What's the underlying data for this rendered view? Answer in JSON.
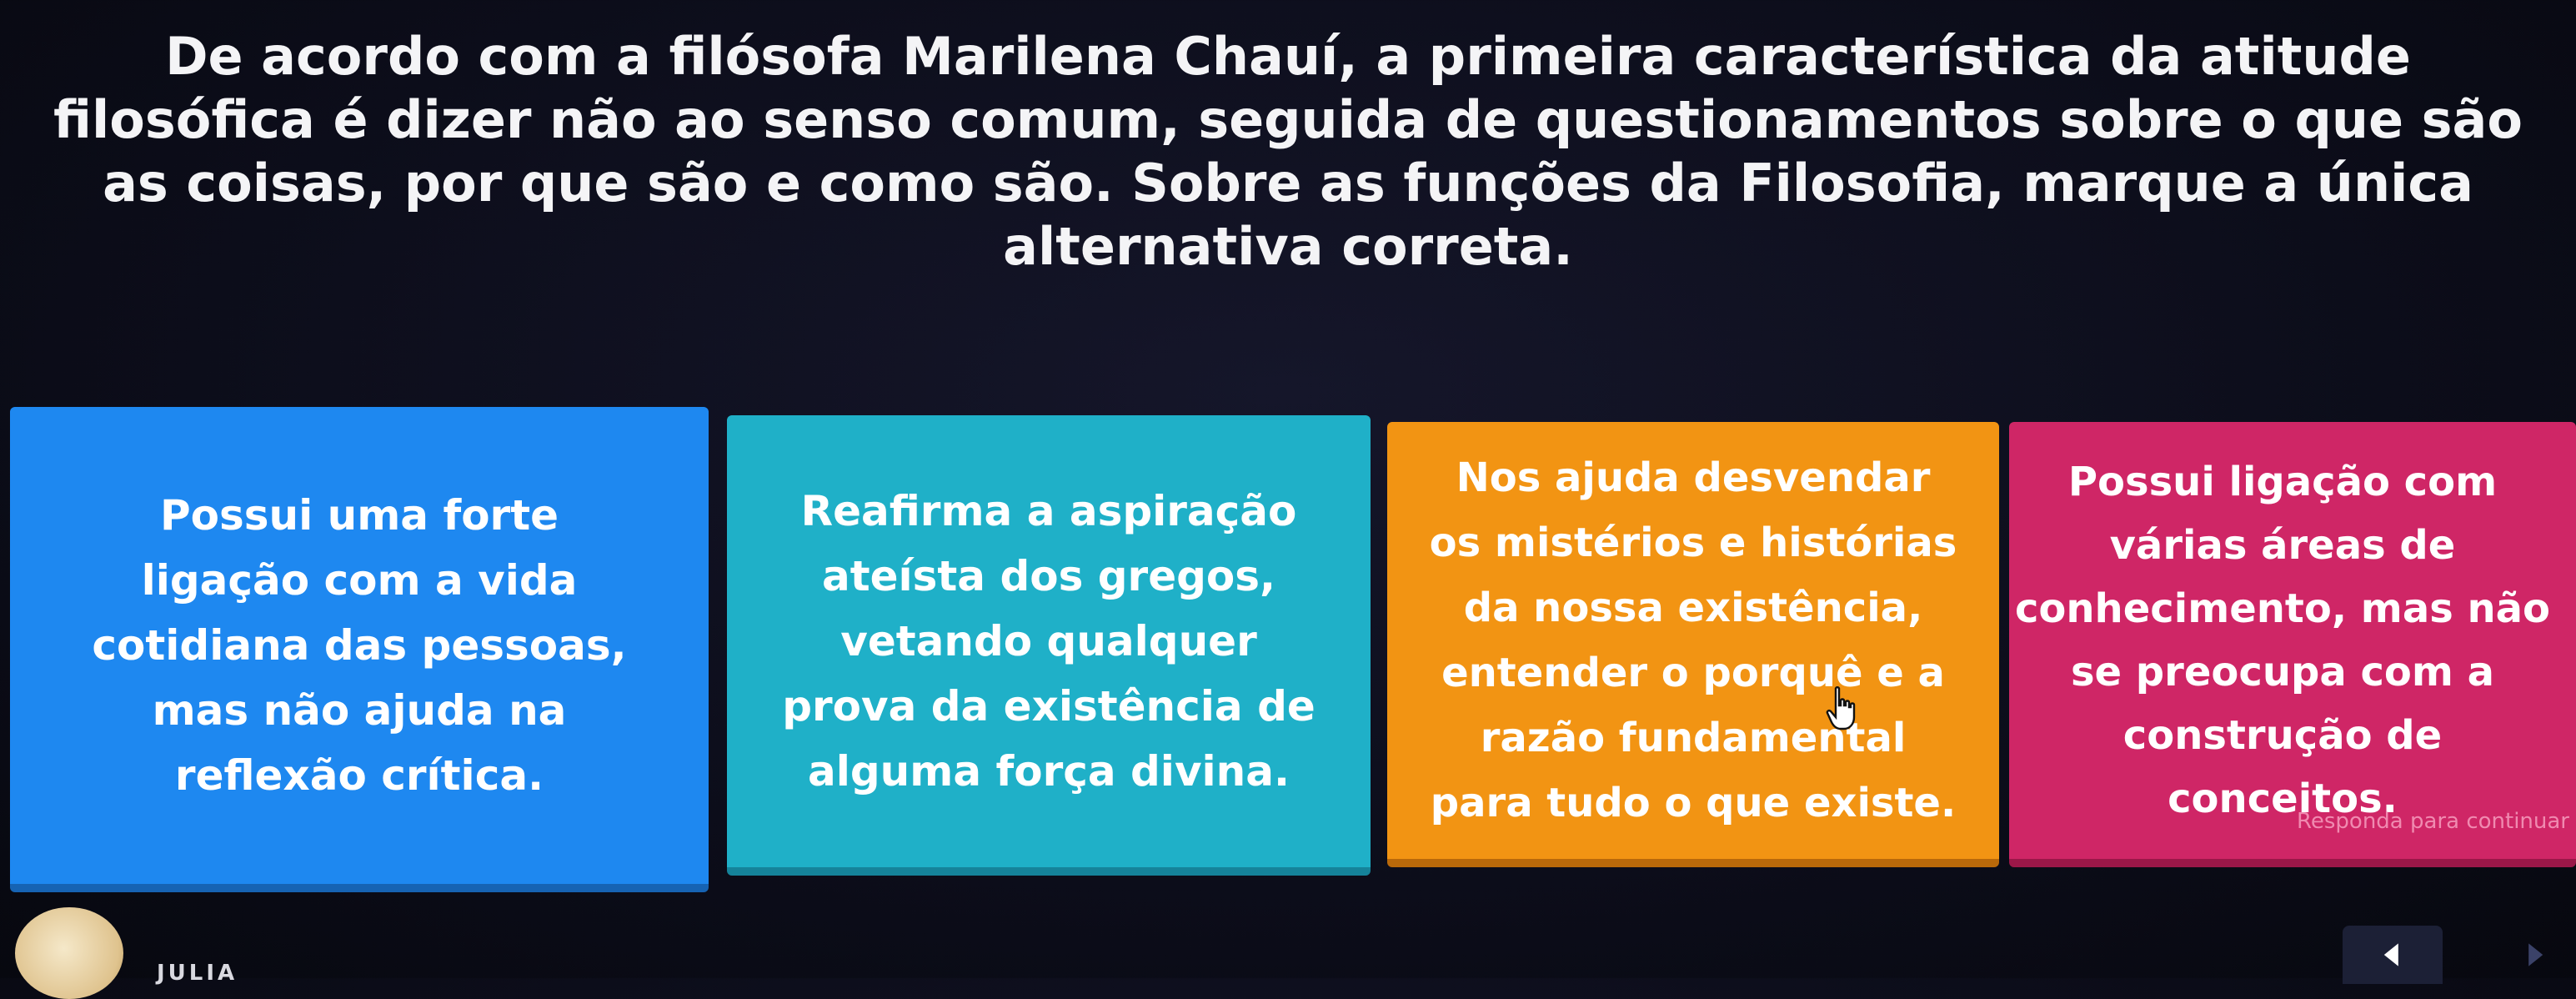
{
  "question": {
    "text": "De acordo com a filósofa Marilena Chauí, a primeira característica da atitude filosófica é dizer não ao senso comum, seguida de questionamentos sobre o que são as coisas, por que são e como são. Sobre as funções da Filosofia, marque a única alternativa correta."
  },
  "answers": [
    {
      "text": "Possui uma forte\nligação com a vida\ncotidiana das pessoas,\nmas não ajuda na\nreflexão crítica.",
      "color": "#1e88f0"
    },
    {
      "text": "Reafirma a aspiração\nateísta dos gregos,\nvetando qualquer\nprova da existência de\nalguma força divina.",
      "color": "#1fb0c8"
    },
    {
      "text": "Nos ajuda desvendar\nos mistérios e histórias\nda nossa existência,\nentender o porquê e a\nrazão fundamental\npara tudo o que existe.",
      "color": "#f29413"
    },
    {
      "text": "Possui ligação com\nvárias áreas de\nconhecimento, mas não\nse preocupa com a\nconstrução de\nconceitos.",
      "color": "#cf2666"
    }
  ],
  "hint": "Responda para continuar",
  "player": {
    "name": "JULIA"
  },
  "icons": {
    "cursor": "hand-pointer-icon",
    "prev": "chevron-left-icon",
    "next": "chevron-right-icon"
  }
}
